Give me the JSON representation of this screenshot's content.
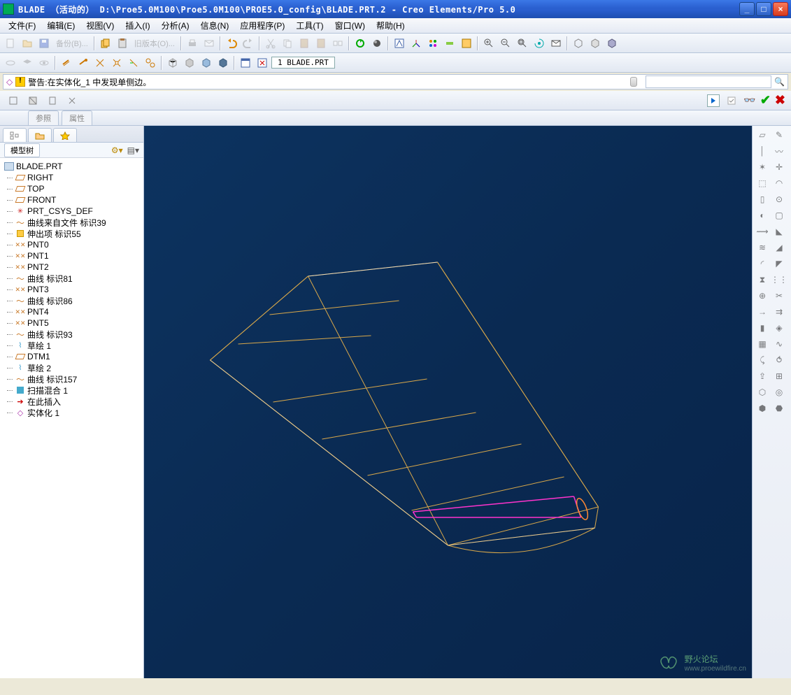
{
  "window": {
    "title": "BLADE （活动的） D:\\Proe5.0M100\\Proe5.0M100\\PROE5.0_config\\BLADE.PRT.2 - Creo Elements/Pro 5.0"
  },
  "menu": {
    "items": [
      "文件(F)",
      "编辑(E)",
      "视图(V)",
      "插入(I)",
      "分析(A)",
      "信息(N)",
      "应用程序(P)",
      "工具(T)",
      "窗口(W)",
      "帮助(H)"
    ]
  },
  "toolbar": {
    "backup_label": "备份(B)...",
    "oldver_label": "旧版本(O)...",
    "open_tab": "1 BLADE.PRT"
  },
  "message": {
    "icon": "warning",
    "text": "警告:在实体化_1 中发现单侧边。"
  },
  "dashboard": {
    "tabs": [
      "参照",
      "属性"
    ]
  },
  "modeltree": {
    "header": "模型树",
    "root": "BLADE.PRT",
    "items": [
      {
        "icon": "plane",
        "label": "RIGHT"
      },
      {
        "icon": "plane",
        "label": "TOP"
      },
      {
        "icon": "plane",
        "label": "FRONT"
      },
      {
        "icon": "csys",
        "label": "PRT_CSYS_DEF"
      },
      {
        "icon": "curve",
        "label": "曲线来自文件 标识39"
      },
      {
        "icon": "ext",
        "label": "伸出项 标识55"
      },
      {
        "icon": "pnt",
        "label": "PNT0"
      },
      {
        "icon": "pnt",
        "label": "PNT1"
      },
      {
        "icon": "pnt",
        "label": "PNT2"
      },
      {
        "icon": "curve",
        "label": "曲线 标识81"
      },
      {
        "icon": "pnt",
        "label": "PNT3"
      },
      {
        "icon": "curve",
        "label": "曲线 标识86"
      },
      {
        "icon": "pnt",
        "label": "PNT4"
      },
      {
        "icon": "pnt",
        "label": "PNT5"
      },
      {
        "icon": "curve",
        "label": "曲线 标识93"
      },
      {
        "icon": "sketch",
        "label": "草绘 1"
      },
      {
        "icon": "plane",
        "label": "DTM1"
      },
      {
        "icon": "sketch",
        "label": "草绘 2"
      },
      {
        "icon": "curve",
        "label": "曲线 标识157"
      },
      {
        "icon": "swp",
        "label": "扫描混合 1"
      },
      {
        "icon": "arrow",
        "label": "在此插入"
      },
      {
        "icon": "solid",
        "label": "实体化 1"
      }
    ]
  },
  "watermark": {
    "main": "野火论坛",
    "sub": "www.proewildfire.cn"
  }
}
